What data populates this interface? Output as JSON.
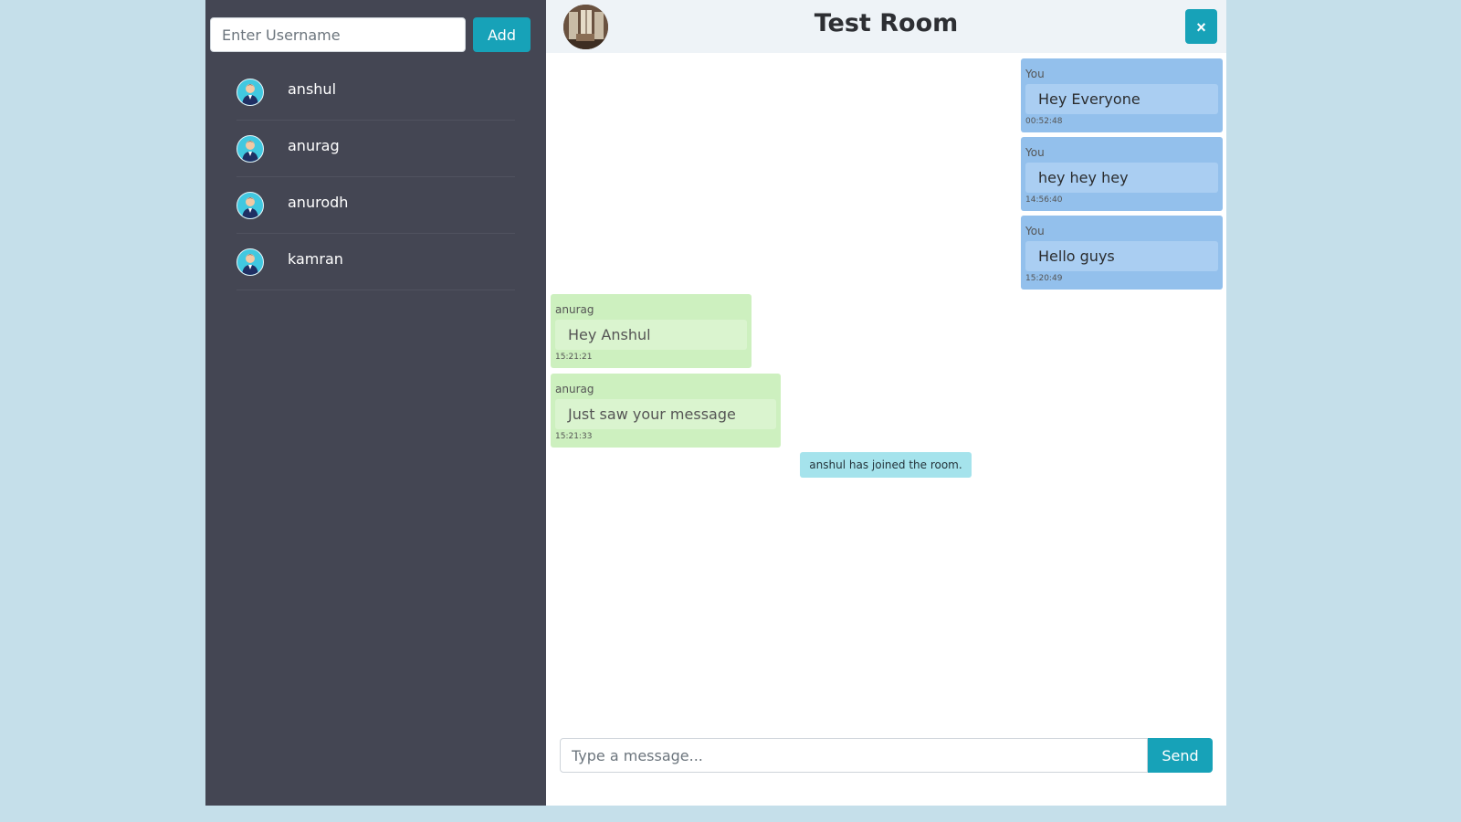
{
  "sidebar": {
    "username_input": {
      "placeholder": "Enter Username",
      "value": ""
    },
    "add_label": "Add",
    "users": [
      {
        "name": "anshul",
        "avatar_icon": "user-avatar-icon"
      },
      {
        "name": "anurag",
        "avatar_icon": "user-avatar-icon"
      },
      {
        "name": "anurodh",
        "avatar_icon": "user-avatar-icon"
      },
      {
        "name": "kamran",
        "avatar_icon": "user-avatar-icon"
      }
    ]
  },
  "chat": {
    "room_title": "Test Room",
    "close_label": "×",
    "messages": [
      {
        "sender": "You",
        "text": "Hey Everyone",
        "time": "00:52:48",
        "own": true
      },
      {
        "sender": "You",
        "text": "hey hey hey",
        "time": "14:56:40",
        "own": true
      },
      {
        "sender": "You",
        "text": "Hello guys",
        "time": "15:20:49",
        "own": true
      },
      {
        "sender": "anurag",
        "text": "Hey Anshul",
        "time": "15:21:21",
        "own": false
      },
      {
        "sender": "anurag",
        "text": "Just saw your message",
        "time": "15:21:33",
        "own": false
      }
    ],
    "system_note": "anshul has joined the room.",
    "composer": {
      "placeholder": "Type a message...",
      "value": ""
    },
    "send_label": "Send"
  },
  "colors": {
    "accent": "#17a2b8",
    "sidebar_bg": "#444653",
    "own_message_bg": "#93c0ec",
    "other_message_bg": "#cdf0bf",
    "system_note_bg": "#a5e3ec"
  }
}
